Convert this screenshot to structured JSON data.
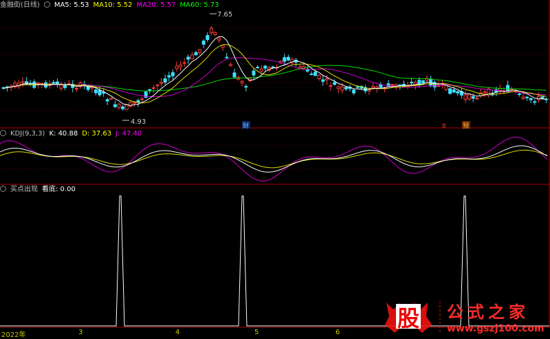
{
  "header_main": {
    "title": "金融街(日线)",
    "ma5": "MA5: 5.53",
    "ma10": "MA10: 5.52",
    "ma20": "MA20: 5.57",
    "ma60": "MA60: 5.73",
    "colors": {
      "ma5": "#ffffff",
      "ma10": "#ffff00",
      "ma20": "#ff00ff",
      "ma60": "#00ff00"
    }
  },
  "header_kdj": {
    "title": "KDJ(9,3,3)",
    "k": "K: 40.88",
    "d": "D: 37.63",
    "j": "J: 47.40"
  },
  "header_signal": {
    "title": "买点出现",
    "value": "看底: 0.00"
  },
  "price_labels": {
    "high": "7.65",
    "low": "4.93"
  },
  "event_labels": {
    "cai": "财",
    "s": "8",
    "yu": "预"
  },
  "x_axis": {
    "start": "2022年",
    "ticks": [
      "3",
      "4",
      "5",
      "6"
    ]
  },
  "watermark": {
    "glyph": "股",
    "name": "公式之家",
    "url": "www.gszj100.com"
  },
  "chart_data": {
    "type": "candlestick",
    "title": "金融街(日线)",
    "ylim": [
      4.93,
      7.65
    ],
    "price_high": 7.65,
    "price_low": 4.93,
    "indicators": [
      "MA5",
      "MA10",
      "MA20",
      "MA60",
      "KDJ(9,3,3)",
      "买点出现"
    ],
    "kdj_last": {
      "K": 40.88,
      "D": 37.63,
      "J": 47.4
    },
    "signal_last": 0,
    "signal_spikes_at_months": [
      "3",
      "5",
      "6"
    ]
  }
}
